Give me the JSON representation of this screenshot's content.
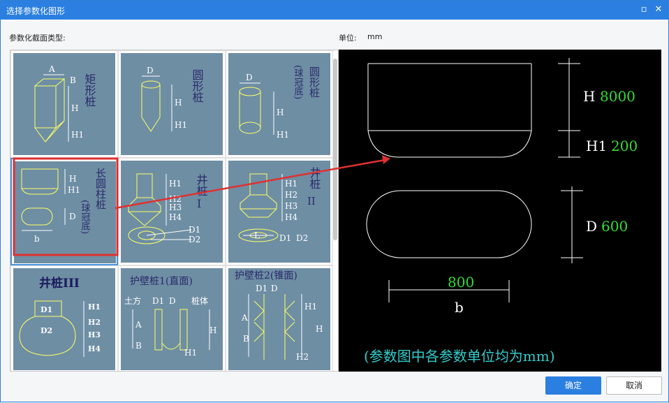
{
  "window": {
    "title": "选择参数化图形"
  },
  "labels": {
    "section_type": "参数化截面类型:",
    "unit_label": "单位:",
    "unit_value": "mm"
  },
  "shapes": [
    {
      "name": "矩形桩"
    },
    {
      "name": "圆形桩"
    },
    {
      "name": "圆形桩(球冠底)"
    },
    {
      "name": "长圆柱桩(球冠底)"
    },
    {
      "name": "井桩I"
    },
    {
      "name": "井桩II"
    },
    {
      "name": "井桩III"
    },
    {
      "name": "护壁桩1(直面)"
    },
    {
      "name": "护壁桩2(锥面)"
    }
  ],
  "thumb_text": {
    "rect": {
      "title": "矩形桩",
      "a": "A",
      "b": "B",
      "h": "H",
      "h1": "H1"
    },
    "round": {
      "title": "圆形桩",
      "d": "D",
      "h": "H",
      "h1": "H1"
    },
    "round_cap": {
      "title1": "圆形桩",
      "title2": "(球冠底)",
      "d": "D",
      "h": "H",
      "h1": "H1"
    },
    "long": {
      "title1": "长圆柱桩",
      "title2": "(球冠底)",
      "h": "H",
      "h1": "H1",
      "d": "D",
      "b": "b"
    },
    "well1": {
      "title": "井桩",
      "roman": "I",
      "h1": "H1",
      "h2": "H2",
      "h3": "H3",
      "h4": "H4",
      "d1": "D1",
      "d2": "D2"
    },
    "well2": {
      "title": "井桩",
      "roman": "II",
      "h1": "H1",
      "h2": "H2",
      "h3": "H3",
      "h4": "H4",
      "l": "L",
      "d1": "D1",
      "d2": "D2"
    },
    "well3": {
      "title": "井桩III",
      "h1": "H1",
      "h2": "H2",
      "h3": "H3",
      "h4": "H4",
      "d1": "D1",
      "d2": "D2"
    },
    "wall1": {
      "title": "护壁桩1(直面)",
      "soil": "土方",
      "d1": "D1",
      "d": "D",
      "body": "桩体",
      "a": "A",
      "b": "B",
      "h": "H",
      "h1": "H1"
    },
    "wall2": {
      "title": "护壁桩2(锥面)",
      "d1": "D1",
      "d": "D",
      "a": "A",
      "b": "B",
      "h": "H",
      "h1": "H1",
      "h2": "H2"
    }
  },
  "preview": {
    "h_label": "H",
    "h_value": "8000",
    "h1_label": "H1",
    "h1_value": "200",
    "d_label": "D",
    "d_value": "600",
    "b_value": "800",
    "b_label": "b",
    "note": "(参数图中各参数单位均为mm)"
  },
  "buttons": {
    "ok": "确定",
    "cancel": "取消"
  },
  "colors": {
    "accent": "#2b7fe0",
    "thumb_bg": "#6e8ea4",
    "value_green": "#33dd33",
    "note_cyan": "#33cccc",
    "highlight_red": "#e03030"
  }
}
